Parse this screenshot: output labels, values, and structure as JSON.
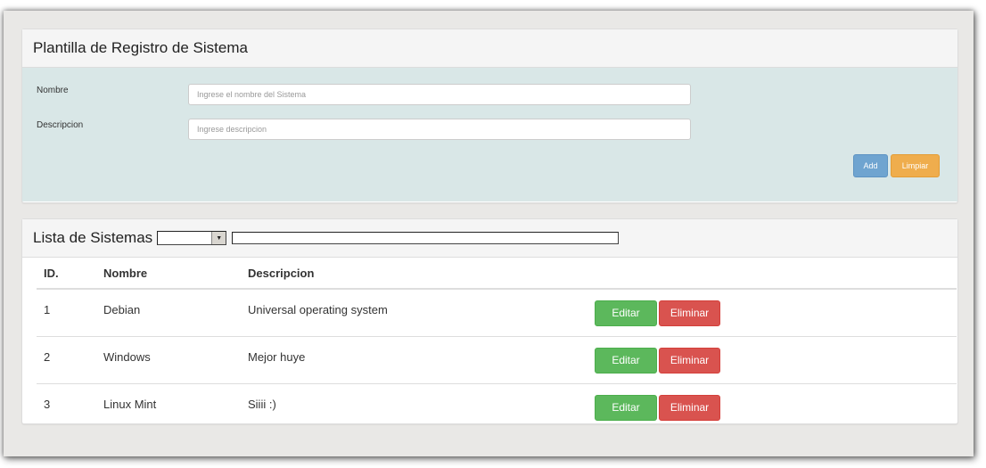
{
  "form_panel": {
    "title": "Plantilla de Registro de Sistema",
    "fields": {
      "nombre": {
        "label": "Nombre",
        "placeholder": "Ingrese el nombre del Sistema",
        "value": ""
      },
      "descripcion": {
        "label": "Descripcion",
        "placeholder": "Ingrese descripcion",
        "value": ""
      }
    },
    "buttons": {
      "add": "Add",
      "clear": "Limpiar"
    }
  },
  "list_panel": {
    "title": "Lista de Sistemas",
    "filter": {
      "selected": "",
      "search_value": ""
    },
    "columns": {
      "id": "ID.",
      "name": "Nombre",
      "description": "Descripcion"
    },
    "rows": [
      {
        "id": "1",
        "name": "Debian",
        "description": "Universal operating system",
        "edit": "Editar",
        "delete": "Eliminar"
      },
      {
        "id": "2",
        "name": "Windows",
        "description": "Mejor huye",
        "edit": "Editar",
        "delete": "Eliminar"
      },
      {
        "id": "3",
        "name": "Linux Mint",
        "description": "Siiii :)",
        "edit": "Editar",
        "delete": "Eliminar"
      }
    ]
  },
  "colors": {
    "form_body_bg": "#d9e7e7",
    "add_button": "#6fa4d0",
    "clear_button": "#efad4d",
    "edit_button": "#5cb85c",
    "delete_button": "#d9534f"
  },
  "icons": {
    "select_arrow": "triangle-down-icon"
  }
}
